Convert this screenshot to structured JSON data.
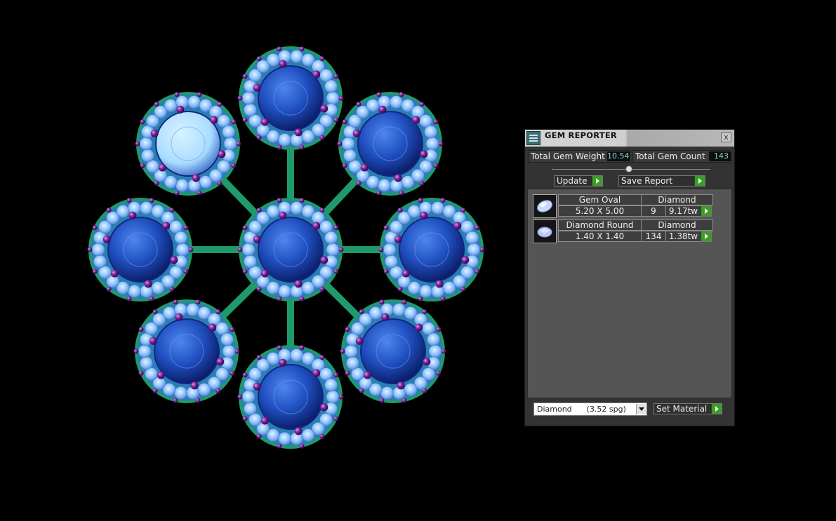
{
  "panel": {
    "title": "GEM REPORTER",
    "close_label": "x",
    "total_weight_label": "Total Gem Weight",
    "total_weight_value": "10.54",
    "total_count_label": "Total Gem Count",
    "total_count_value": "143",
    "update_label": "Update",
    "save_report_label": "Save Report",
    "gems": [
      {
        "name": "Gem Oval",
        "material": "Diamond",
        "size": "5.20 X 5.00",
        "count": "9",
        "weight": "9.17tw",
        "shape": "oval"
      },
      {
        "name": "Diamond Round",
        "material": "Diamond",
        "size": "1.40 X 1.40",
        "count": "134",
        "weight": "1.38tw",
        "shape": "round"
      }
    ],
    "material_select_value": "Diamond      (3.52 spg)",
    "set_material_label": "Set Material"
  },
  "colors": {
    "background": "#000000",
    "panel": "#333333",
    "accent_green": "#3f9a2a",
    "value_text": "#7ad7cf",
    "metal": "#1f9a6b",
    "large_stone": "#1f4fc0",
    "pave_stone": "#8ec4ff",
    "prong": "#7a1f9a"
  }
}
